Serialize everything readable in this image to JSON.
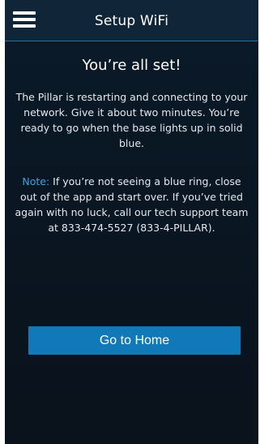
{
  "header": {
    "title": "Setup WiFi",
    "menu_icon": "hamburger-menu-icon"
  },
  "content": {
    "heading": "You’re all set!",
    "message": "The Pillar is restarting and connecting to your network. Give it about two minutes. You’re ready to go when the base lights up in solid blue.",
    "note_label": "Note:",
    "note_text": " If you’re not seeing a blue ring, close out of the app and start over. If you’ve tried again with no luck, call our tech support team at 833-474-5527 (833-4-PILLAR)."
  },
  "actions": {
    "home_button_label": "Go to Home"
  },
  "colors": {
    "accent": "#1179b8",
    "note_label": "#3ea3dc",
    "background": "#0a1622",
    "header_border": "#2e6f9a"
  }
}
